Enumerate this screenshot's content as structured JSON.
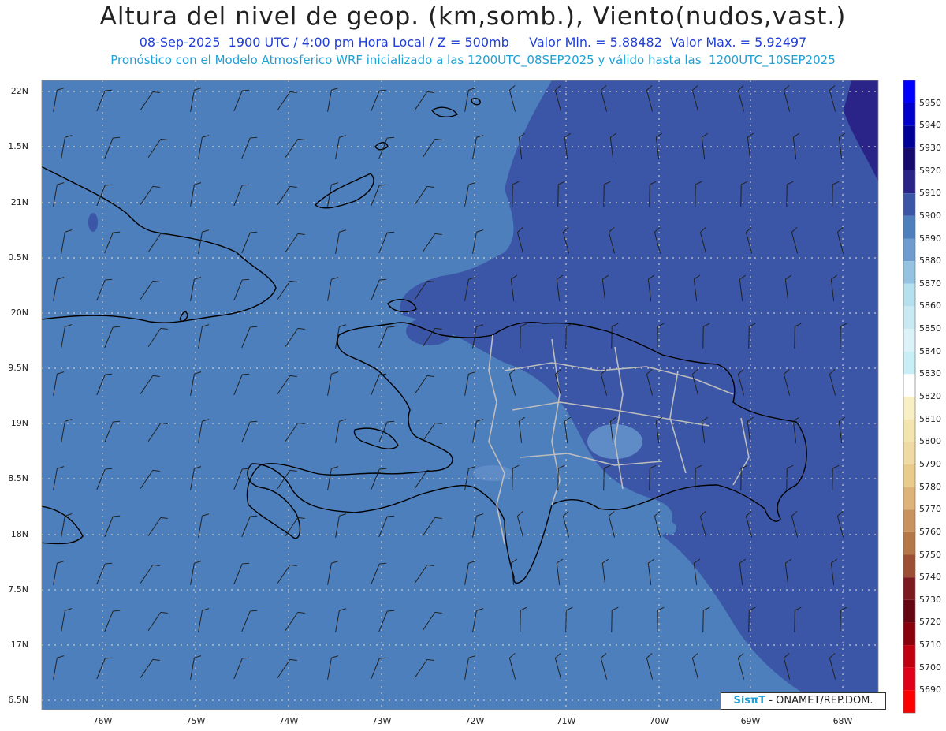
{
  "header": {
    "title": "Altura del nivel de geop. (km,somb.), Viento(nudos,vast.)",
    "subtitle_1": "08-Sep-2025  1900 UTC / 4:00 pm Hora Local / Z = 500mb     Valor Min. = 5.88482  Valor Max. = 5.92497",
    "subtitle_2": "Pronóstico con el Modelo Atmosferico WRF inicializado a las 1200UTC_08SEP2025 y válido hasta las  1200UTC_10SEP2025"
  },
  "axes": {
    "lat_labels": [
      "22N",
      "1.5N",
      "21N",
      "0.5N",
      "20N",
      "9.5N",
      "19N",
      "8.5N",
      "18N",
      "7.5N",
      "17N",
      "6.5N"
    ],
    "lon_labels": [
      "76W",
      "75W",
      "74W",
      "73W",
      "72W",
      "71W",
      "70W",
      "69W",
      "68W"
    ]
  },
  "colorbar": {
    "labels": [
      "5950",
      "5940",
      "5930",
      "5920",
      "5910",
      "5900",
      "5890",
      "5880",
      "5870",
      "5860",
      "5850",
      "5840",
      "5830",
      "5820",
      "5810",
      "5800",
      "5790",
      "5780",
      "5770",
      "5760",
      "5750",
      "5740",
      "5730",
      "5720",
      "5710",
      "5700",
      "5690"
    ],
    "colors": [
      "#0000ff",
      "#0000cc",
      "#000099",
      "#160a6e",
      "#2a2488",
      "#3b56a6",
      "#4d7fbd",
      "#6f9ccf",
      "#93c3e0",
      "#b7e0ee",
      "#c9eaf3",
      "#dbf2f8",
      "#c8eef6",
      "#ffffff",
      "#f8f0c4",
      "#f3e4b0",
      "#efdaa3",
      "#e9cb8c",
      "#ddb37a",
      "#c99360",
      "#b47748",
      "#9c4f34",
      "#7c1a20",
      "#660612",
      "#8a000c",
      "#c00010",
      "#e0001a",
      "#ff0000"
    ]
  },
  "fill_colors": {
    "ocean": "#4d7fbd",
    "high": "#3b56a6",
    "highest": "#2a2488",
    "land_light": "#5f8cc6"
  },
  "credit": {
    "brand": "SisπT",
    "text": " - ONAMET/REP.DOM."
  }
}
